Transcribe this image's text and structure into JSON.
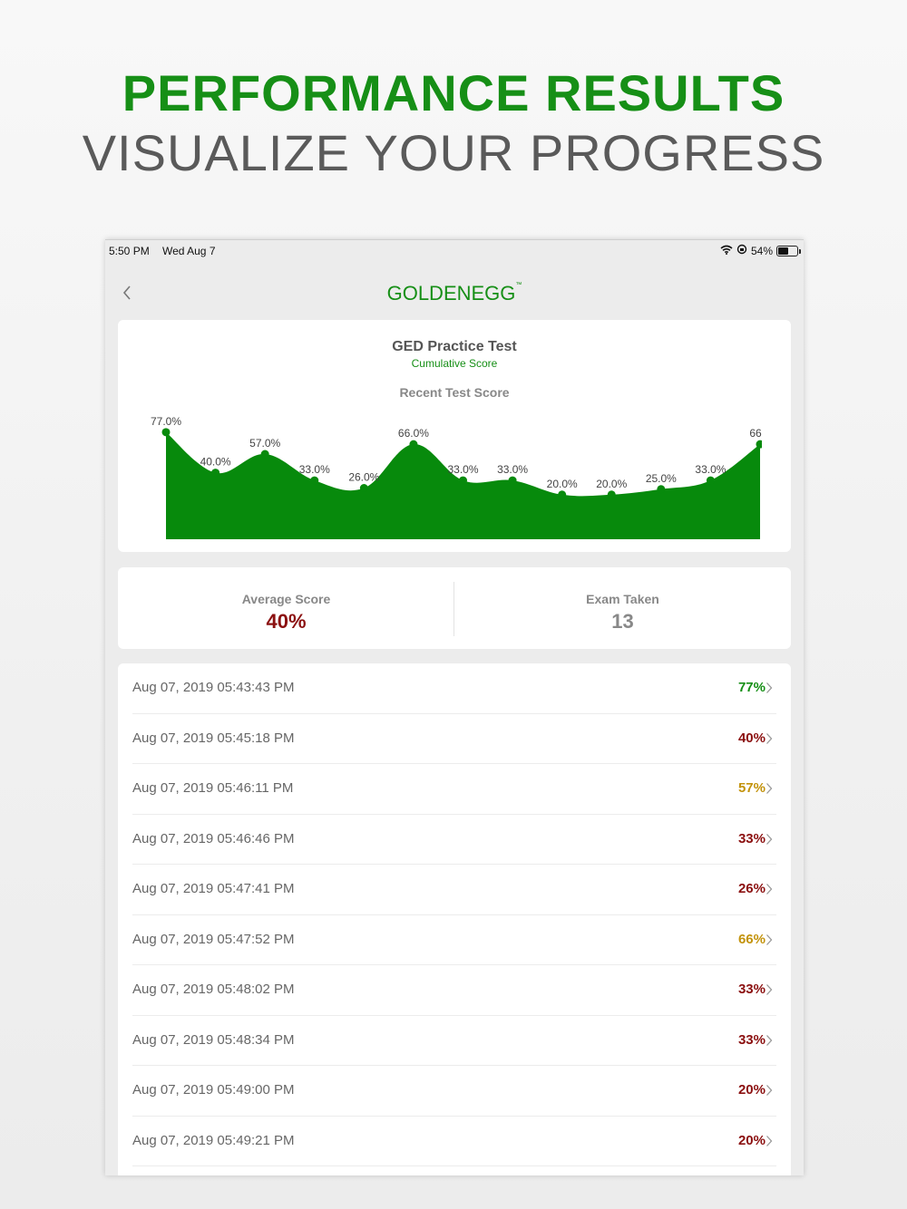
{
  "promo": {
    "title": "PERFORMANCE RESULTS",
    "subtitle": "VISUALIZE YOUR PROGRESS"
  },
  "status_bar": {
    "time": "5:50 PM",
    "date": "Wed Aug 7",
    "battery": "54%",
    "battery_level": 0.54,
    "icons": [
      "wifi-icon",
      "rotation-lock-icon",
      "battery-icon"
    ]
  },
  "nav": {
    "back_icon": "chevron-left-icon",
    "logo_text": "GOLDENEGG",
    "logo_mark": "™"
  },
  "colors": {
    "brand_green": "#168f16",
    "chart_green": "#078a0c",
    "score_low": "#8b1010",
    "score_mid": "#c3930c",
    "score_high": "#168f16"
  },
  "chart_card": {
    "title": "GED Practice Test",
    "subtitle": "Cumulative Score",
    "heading": "Recent Test Score"
  },
  "chart_data": {
    "type": "area",
    "title": "Recent Test Score",
    "x": [
      1,
      2,
      3,
      4,
      5,
      6,
      7,
      8,
      9,
      10,
      11,
      12,
      13
    ],
    "values": [
      77.0,
      40.0,
      57.0,
      33.0,
      26.0,
      66.0,
      33.0,
      33.0,
      20.0,
      20.0,
      25.0,
      33.0,
      66.0
    ],
    "labels": [
      "77.0%",
      "40.0%",
      "57.0%",
      "33.0%",
      "26.0%",
      "66.0%",
      "33.0%",
      "33.0%",
      "20.0%",
      "20.0%",
      "25.0%",
      "33.0%",
      "66.0"
    ],
    "ylim": [
      0,
      100
    ],
    "grid": false,
    "legend": "none"
  },
  "stats": {
    "average_label": "Average Score",
    "average_value": "40%",
    "exams_label": "Exam Taken",
    "exams_value": "13"
  },
  "results": [
    {
      "date": "Aug 07, 2019 05:43:43 PM",
      "score": "77%",
      "level": "high"
    },
    {
      "date": "Aug 07, 2019 05:45:18 PM",
      "score": "40%",
      "level": "low"
    },
    {
      "date": "Aug 07, 2019 05:46:11 PM",
      "score": "57%",
      "level": "mid"
    },
    {
      "date": "Aug 07, 2019 05:46:46 PM",
      "score": "33%",
      "level": "low"
    },
    {
      "date": "Aug 07, 2019 05:47:41 PM",
      "score": "26%",
      "level": "low"
    },
    {
      "date": "Aug 07, 2019 05:47:52 PM",
      "score": "66%",
      "level": "mid"
    },
    {
      "date": "Aug 07, 2019 05:48:02 PM",
      "score": "33%",
      "level": "low"
    },
    {
      "date": "Aug 07, 2019 05:48:34 PM",
      "score": "33%",
      "level": "low"
    },
    {
      "date": "Aug 07, 2019 05:49:00 PM",
      "score": "20%",
      "level": "low"
    },
    {
      "date": "Aug 07, 2019 05:49:21 PM",
      "score": "20%",
      "level": "low"
    }
  ]
}
